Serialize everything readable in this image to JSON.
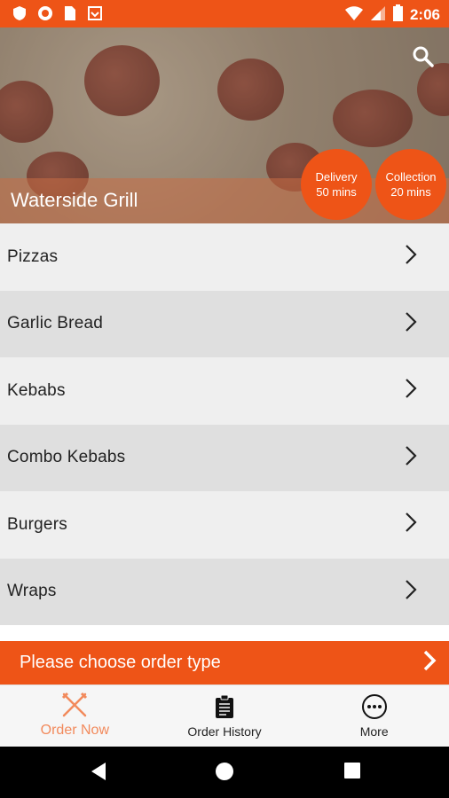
{
  "status_bar": {
    "time": "2:06",
    "icons": [
      "shield-icon",
      "record-icon",
      "sim-card-icon",
      "download-icon",
      "wifi-icon",
      "signal-icon",
      "battery-icon"
    ]
  },
  "restaurant": {
    "name": "Waterside Grill",
    "delivery_label": "Delivery",
    "delivery_time": "50 mins",
    "collection_label": "Collection",
    "collection_time": "20 mins"
  },
  "menu": {
    "categories": [
      "Pizzas",
      "Garlic Bread",
      "Kebabs",
      "Combo Kebabs",
      "Burgers",
      "Wraps"
    ]
  },
  "order_bar": {
    "text": "Please choose order type"
  },
  "tabs": [
    {
      "label": "Order Now",
      "icon": "fork-knife-icon",
      "active": true
    },
    {
      "label": "Order History",
      "icon": "clipboard-icon",
      "active": false
    },
    {
      "label": "More",
      "icon": "more-dots-icon",
      "active": false
    }
  ],
  "colors": {
    "accent": "#ee5417",
    "active_tab": "#f28a5c",
    "row_light": "#efefef",
    "row_dark": "#dfdfdf"
  }
}
